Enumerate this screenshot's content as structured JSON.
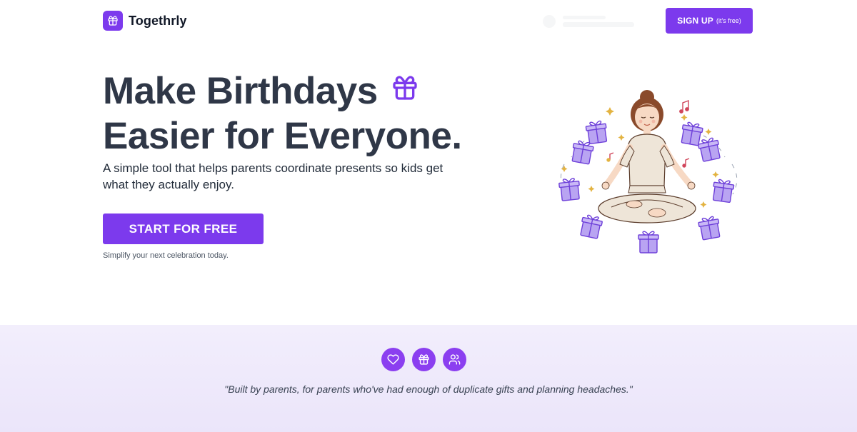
{
  "header": {
    "brand_name": "Togethrly",
    "signup_label": "SIGN UP",
    "signup_sub": "(it's free)"
  },
  "hero": {
    "title_line1": "Make Birthdays",
    "title_line2": "Easier for Everyone.",
    "subtitle": "A simple tool that helps parents coordinate presents so kids get what they actually enjoy.",
    "cta_label": "START FOR FREE",
    "cta_note": "Simplify your next celebration today."
  },
  "testimonial": {
    "icons": [
      "heart-icon",
      "gift-icon",
      "users-icon"
    ],
    "quote": "\"Built by parents, for parents who've had enough of duplicate gifts and planning headaches.\""
  },
  "colors": {
    "accent": "#7c3aed",
    "heading": "#2f3747",
    "band_bg": "#efeafc"
  }
}
